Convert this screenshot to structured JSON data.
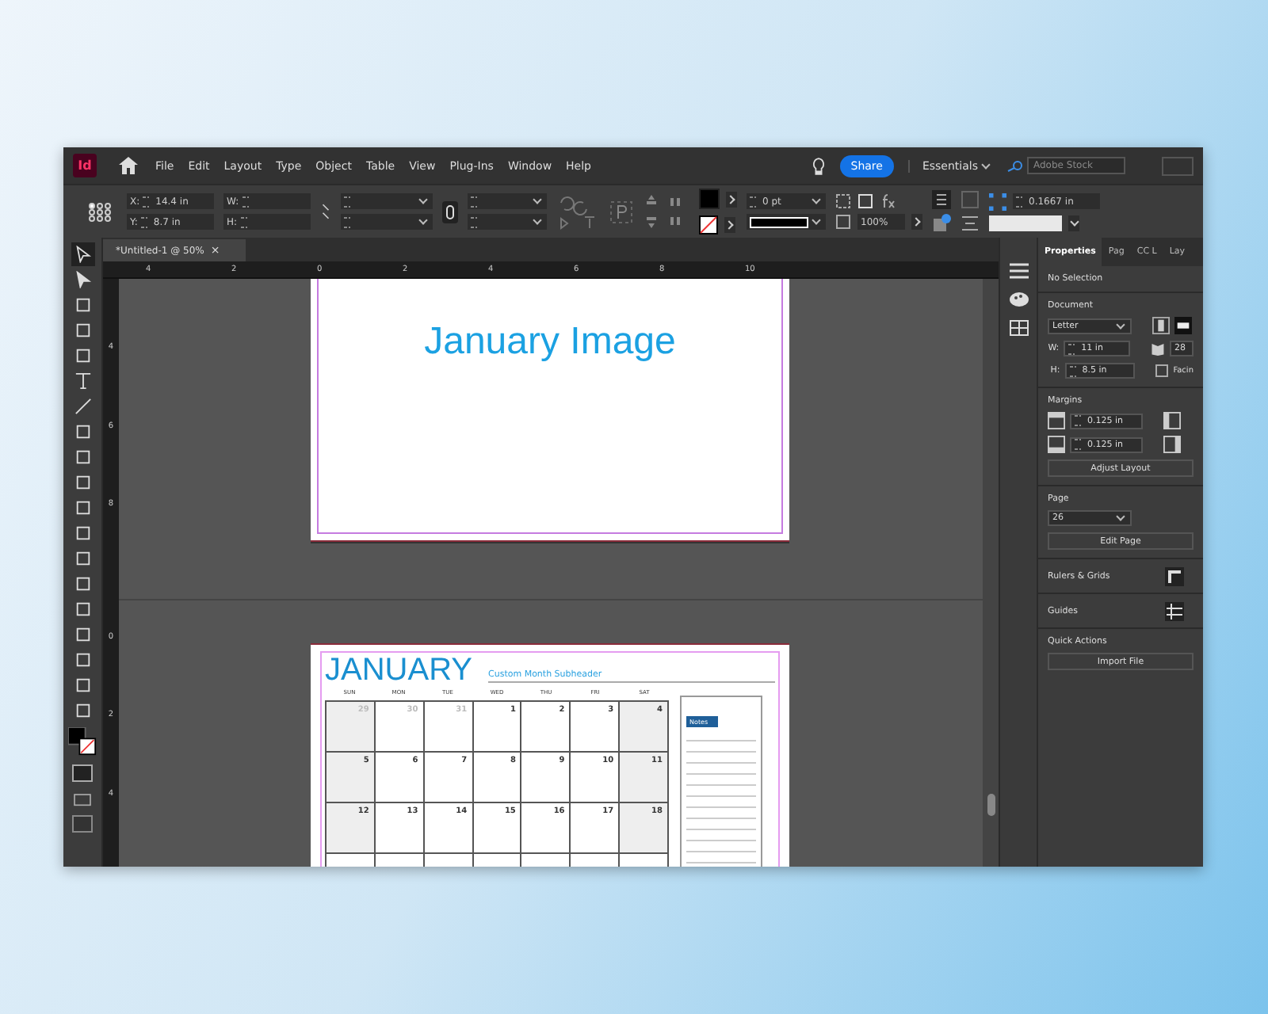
{
  "app": {
    "logo": "Id"
  },
  "menu": [
    "File",
    "Edit",
    "Layout",
    "Type",
    "Object",
    "Table",
    "View",
    "Plug-Ins",
    "Window",
    "Help"
  ],
  "share": "Share",
  "workspace": "Essentials",
  "stock_search": {
    "placeholder": "Adobe Stock"
  },
  "control": {
    "x_label": "X:",
    "x": "14.4 in",
    "y_label": "Y:",
    "y": "8.7 in",
    "w_label": "W:",
    "h_label": "H:",
    "stroke_weight": "0 pt",
    "scale": "100%",
    "offset": "0.1667 in"
  },
  "document_tab": {
    "title": "*Untitled-1 @ 50%",
    "close": "×"
  },
  "ruler": [
    "4",
    "2",
    "0",
    "2",
    "4",
    "6",
    "8",
    "10"
  ],
  "vertical_ruler": [
    "4",
    "6",
    "8",
    "0",
    "2",
    "4"
  ],
  "image_page": {
    "title": "January Image"
  },
  "calendar": {
    "month": "JANUARY",
    "subheader": "Custom Month Subheader",
    "notes": "Notes",
    "weekdays": [
      "SUN",
      "MON",
      "TUE",
      "WED",
      "THU",
      "FRI",
      "SAT"
    ],
    "weeks": [
      [
        {
          "day": "29",
          "muted": true,
          "shaded": true
        },
        {
          "day": "30",
          "muted": true,
          "shaded": false
        },
        {
          "day": "31",
          "muted": true,
          "shaded": false
        },
        {
          "day": "1",
          "muted": false,
          "shaded": false
        },
        {
          "day": "2",
          "muted": false,
          "shaded": false
        },
        {
          "day": "3",
          "muted": false,
          "shaded": false
        },
        {
          "day": "4",
          "muted": false,
          "shaded": true
        }
      ],
      [
        {
          "day": "5",
          "muted": false,
          "shaded": true
        },
        {
          "day": "6",
          "muted": false,
          "shaded": false
        },
        {
          "day": "7",
          "muted": false,
          "shaded": false
        },
        {
          "day": "8",
          "muted": false,
          "shaded": false
        },
        {
          "day": "9",
          "muted": false,
          "shaded": false
        },
        {
          "day": "10",
          "muted": false,
          "shaded": false
        },
        {
          "day": "11",
          "muted": false,
          "shaded": true
        }
      ],
      [
        {
          "day": "12",
          "muted": false,
          "shaded": true
        },
        {
          "day": "13",
          "muted": false,
          "shaded": false
        },
        {
          "day": "14",
          "muted": false,
          "shaded": false
        },
        {
          "day": "15",
          "muted": false,
          "shaded": false
        },
        {
          "day": "16",
          "muted": false,
          "shaded": false
        },
        {
          "day": "17",
          "muted": false,
          "shaded": false
        },
        {
          "day": "18",
          "muted": false,
          "shaded": true
        }
      ]
    ]
  },
  "properties": {
    "tabs": [
      {
        "label": "Properties",
        "selected": true
      },
      {
        "label": "Pag",
        "selected": false
      },
      {
        "label": "CC L",
        "selected": false
      },
      {
        "label": "Lay",
        "selected": false
      }
    ],
    "selection": "No Selection",
    "document_heading": "Document",
    "preset": "Letter",
    "w_label": "W:",
    "width": "11 in",
    "h_label": "H:",
    "height": "8.5 in",
    "pages": "28",
    "facing": {
      "label": "Facin",
      "checked": false
    },
    "margins_heading": "Margins",
    "margin_top": "0.125 in",
    "margin_bottom": "0.125 in",
    "adjust_layout": "Adjust Layout",
    "page_heading": "Page",
    "page": "26",
    "edit_page": "Edit Page",
    "rulers": "Rulers & Grids",
    "guides": "Guides",
    "quick_actions": "Quick Actions",
    "import_file": "Import File"
  }
}
